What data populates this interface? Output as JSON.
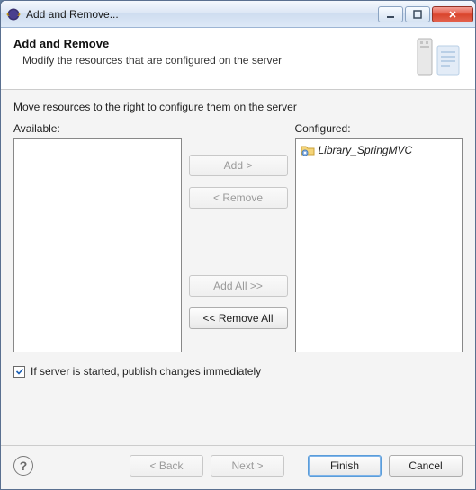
{
  "window": {
    "title": "Add and Remove..."
  },
  "banner": {
    "heading": "Add and Remove",
    "subheading": "Modify the resources that are configured on the server"
  },
  "content": {
    "instruction": "Move resources to the right to configure them on the server",
    "available_label": "Available:",
    "configured_label": "Configured:",
    "available_items": [],
    "configured_items": [
      {
        "label": "Library_SpringMVC"
      }
    ],
    "btn_add": "Add >",
    "btn_remove": "< Remove",
    "btn_add_all": "Add All >>",
    "btn_remove_all": "<< Remove All",
    "checkbox_label": "If server is started, publish changes immediately",
    "checkbox_checked": true
  },
  "footer": {
    "back": "< Back",
    "next": "Next >",
    "finish": "Finish",
    "cancel": "Cancel"
  }
}
